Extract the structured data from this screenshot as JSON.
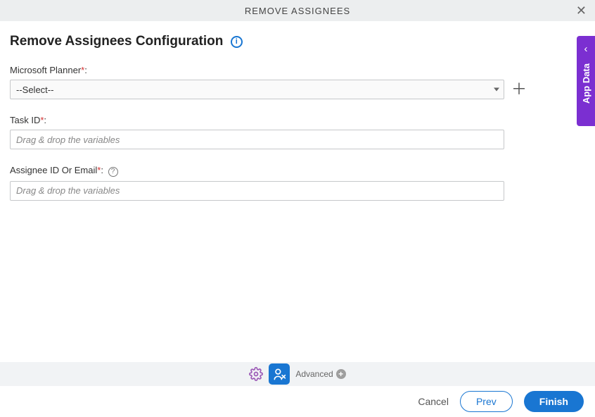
{
  "header": {
    "title": "REMOVE ASSIGNEES",
    "close": "✕"
  },
  "page": {
    "title": "Remove Assignees Configuration",
    "info_glyph": "i"
  },
  "fields": {
    "planner": {
      "label": "Microsoft Planner",
      "required": "*",
      "colon": ":",
      "selected": "--Select--"
    },
    "task_id": {
      "label": "Task ID",
      "required": "*",
      "colon": ":",
      "placeholder": "Drag & drop the variables"
    },
    "assignee": {
      "label": "Assignee ID Or Email",
      "required": "*",
      "colon": ":",
      "help_glyph": "?",
      "placeholder": "Drag & drop the variables"
    },
    "plus_glyph": "＋"
  },
  "side_tab": {
    "chevron": "‹",
    "label": "App Data"
  },
  "toolbar": {
    "advanced_label": "Advanced",
    "adv_plus": "+"
  },
  "footer": {
    "cancel": "Cancel",
    "prev": "Prev",
    "finish": "Finish"
  }
}
